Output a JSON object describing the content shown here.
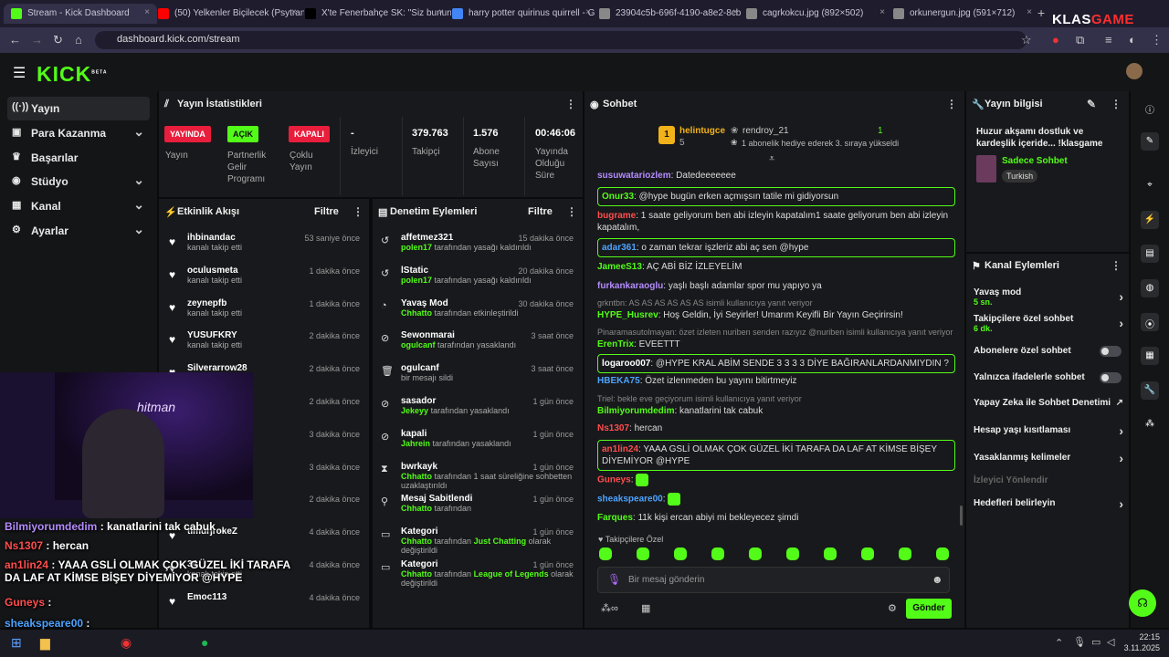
{
  "browser": {
    "tabs": [
      {
        "title": "Stream - Kick Dashboard",
        "active": true,
        "color": "#53fc18"
      },
      {
        "title": "(50) Yelkenler Biçilecek (Psytran",
        "color": "#ff0000"
      },
      {
        "title": "X'te Fenerbahçe SK: \"Siz bunun",
        "color": "#000000"
      },
      {
        "title": "harry potter quirinus quirrell - G",
        "color": "#4285f4"
      },
      {
        "title": "23904c5b-696f-4190-a8e2-8cb",
        "color": "#888888"
      },
      {
        "title": "cagrkokcu.jpg (892×502)",
        "color": "#888888"
      },
      {
        "title": "orkunergun.jpg (591×712)",
        "color": "#888888"
      }
    ],
    "url": "dashboard.kick.com/stream",
    "watermark_a": "KLAS",
    "watermark_b": "GAME"
  },
  "kick": {
    "logo": "KICK",
    "beta": "BETA"
  },
  "sidebar": {
    "items": [
      {
        "label": "Yayın",
        "icon": "((·))",
        "selected": true
      },
      {
        "label": "Para Kazanma",
        "icon": "▣",
        "chevron": true
      },
      {
        "label": "Başarılar",
        "icon": "♛"
      },
      {
        "label": "Stüdyo",
        "icon": "◉",
        "chevron": true
      },
      {
        "label": "Kanal",
        "icon": "▦",
        "chevron": true
      },
      {
        "label": "Ayarlar",
        "icon": "⚙",
        "chevron": true
      }
    ]
  },
  "stats": {
    "title": "Yayın İstatistikleri",
    "live_badge": "YAYINDA",
    "live_label": "Yayın",
    "partner_badge": "AÇIK",
    "partner_label": "Partnerlik Gelir Programı",
    "multi_badge": "KAPALI",
    "multi_label": "Çoklu Yayın",
    "viewers_val": "-",
    "viewers_label": "İzleyici",
    "followers_val": "379.763",
    "followers_label": "Takipçi",
    "subs_val": "1.576",
    "subs_label": "Abone Sayısı",
    "uptime_val": "00:46:06",
    "uptime_label": "Yayında Olduğu Süre"
  },
  "activity": {
    "title": "Etkinlik Akışı",
    "filter": "Filtre",
    "rows": [
      {
        "name": "ihbinandac",
        "sub": "kanalı takip etti",
        "time": "53 saniye önce"
      },
      {
        "name": "oculusmeta",
        "sub": "kanalı takip etti",
        "time": "1 dakika önce"
      },
      {
        "name": "zeynepfb",
        "sub": "kanalı takip etti",
        "time": "1 dakika önce"
      },
      {
        "name": "YUSUFKRY",
        "sub": "kanalı takip etti",
        "time": "2 dakika önce"
      },
      {
        "name": "Silverarrow28",
        "sub": "",
        "time": "2 dakika önce"
      },
      {
        "name": "",
        "sub": "",
        "time": "2 dakika önce"
      },
      {
        "name": "",
        "sub": "",
        "time": "3 dakika önce"
      },
      {
        "name": "dSti",
        "sub": "",
        "time": "3 dakika önce"
      },
      {
        "name": "",
        "sub": "gönderdi",
        "time": "2 dakika önce"
      },
      {
        "name": "timurjrokeZ",
        "sub": "",
        "time": "4 dakika önce"
      },
      {
        "name": "34",
        "sub": "kanalı takip etti",
        "time": "4 dakika önce"
      },
      {
        "name": "Emoc113",
        "sub": "",
        "time": "4 dakika önce"
      }
    ]
  },
  "moderation": {
    "title": "Denetim Eylemleri",
    "filter": "Filtre",
    "rows": [
      {
        "icon": "↺",
        "name": "affetmez321",
        "actor": "polen17",
        "text": "tarafından yasağı kaldırıldı",
        "time": "15 dakika önce"
      },
      {
        "icon": "↺",
        "name": "lStatic",
        "actor": "polen17",
        "text": "tarafından yasağı kaldırıldı",
        "time": "20 dakika önce"
      },
      {
        "icon": "◔",
        "name": "Yavaş Mod",
        "actor": "Chhatto",
        "text": "tarafından etkinleştirildi",
        "time": "30 dakika önce"
      },
      {
        "icon": "⊘",
        "name": "Sewonmarai",
        "actor": "ogulcanf",
        "text": "tarafından yasaklandı",
        "time": "3 saat önce"
      },
      {
        "icon": "🗑",
        "name": "ogulcanf",
        "actor": "",
        "text": "bir mesajı sildi",
        "time": "3 saat önce"
      },
      {
        "icon": "⊘",
        "name": "sasador",
        "actor": "Jekeyy",
        "text": "tarafından yasaklandı",
        "time": "1 gün önce"
      },
      {
        "icon": "⊘",
        "name": "kapali",
        "actor": "Jahrein",
        "text": "tarafından yasaklandı",
        "time": "1 gün önce"
      },
      {
        "icon": "⧗",
        "name": "bwrkayk",
        "actor": "Chhatto",
        "text": "tarafından 1 saat süreliğine sohbetten uzaklaştırıldı",
        "time": "1 gün önce"
      },
      {
        "icon": "⚲",
        "name": "Mesaj Sabitlendi",
        "actor": "Chhatto",
        "text": "tarafından",
        "time": "1 gün önce"
      },
      {
        "icon": "▭",
        "name": "Kategori",
        "actor": "Chhatto",
        "text": "tarafından",
        "green2": "Just Chatting",
        "text2": "olarak değiştirildi",
        "time": "1 gün önce"
      },
      {
        "icon": "▭",
        "name": "Kategori",
        "actor": "Chhatto",
        "text": "tarafından",
        "green2": "League of Legends",
        "text2": "olarak değiştirildi",
        "time": "1 gün önce"
      }
    ]
  },
  "chat": {
    "title": "Sohbet",
    "leader1_name": "helintugce",
    "leader1_count": "5",
    "leader2_name": "rendroy_21",
    "leader2_count": "1",
    "leader2_sub": "1 abonelik hediye ederek 3. sıraya yükseldi",
    "messages": [
      {
        "user": "susuwatariozlem",
        "color": "#b58cff",
        "text": "Datedeeeeeee"
      },
      {
        "user": "Onur33",
        "color": "#53fc18",
        "text": "@hype bugün erken açmışsın tatile mi gidiyorsun",
        "boxed": true
      },
      {
        "user": "bugrame",
        "color": "#ff4d4d",
        "text": "1 saate geliyorum ben abi izleyin kapatalım1 saate geliyorum ben abi izleyin kapatalım,"
      },
      {
        "user": "adar361",
        "color": "#4da3ff",
        "text": "o zaman tekrar işzleriz abi aç sen @hype",
        "boxed": true
      },
      {
        "user": "JameeS13",
        "color": "#53fc18",
        "text": "AÇ ABİ BİZ İZLEYELİM"
      },
      {
        "user": "furkankaraoglu",
        "color": "#b58cff",
        "text": "yaşlı başlı adamlar spor mu yapıyo ya"
      },
      {
        "reply": "grkntbn: AS AS AS AS AS AS isimli kullanıcıya yanıt veriyor",
        "user": "HYPE_Husrev",
        "color": "#53fc18",
        "text": "Hoş Geldin, İyi Seyirler! Umarım Keyifli Bir Yayın Geçirirsin!"
      },
      {
        "reply": "Pinaramasutolmayan: özet izleten nuriben senden razıyız @nuriben isimli kullanıcıya yanıt veriyor",
        "user": "ErenTrix",
        "color": "#53fc18",
        "text": "EVEETTT"
      },
      {
        "user": "logaroo007",
        "color": "#ffffff",
        "text": "@HYPE KRAL ABİM SENDE 3 3 3 3 DİYE BAĞIRANLARDANMIYDIN ?",
        "boxed": true
      },
      {
        "user": "HBEKA75",
        "color": "#4da3ff",
        "text": "Özet izlenmeden bu yayını bitirtmeyiz"
      },
      {
        "reply": "Triel: bekle eve geçiyorum isimli kullanıcıya yanıt veriyor",
        "user": "Bilmiyorumdedim",
        "color": "#53fc18",
        "text": "kanatlarini tak cabuk"
      },
      {
        "user": "Ns1307",
        "color": "#ff4d4d",
        "text": "hercan"
      },
      {
        "user": "an1lin24",
        "color": "#ff4d4d",
        "text": "YAAA GSLİ OLMAK ÇOK GÜZEL İKİ TARAFA DA LAF AT KİMSE BİŞEY DİYEMİYOR @HYPE",
        "boxed": true
      },
      {
        "user": "Guneys",
        "color": "#ff4d4d",
        "text": ""
      },
      {
        "user": "sheakspeare00",
        "color": "#4da3ff",
        "text": ""
      },
      {
        "user": "Farques",
        "color": "#53fc18",
        "text": "11k kişi ercan abiyi mi bekleyecez şimdi"
      }
    ],
    "followers_only": "Takipçilere Özel",
    "input_placeholder": "Bir mesaj gönderin",
    "send": "Gönder"
  },
  "info": {
    "title": "Yayın bilgisi",
    "stream_title": "Huzur akşamı dostluk ve kardeşlik içeride...  !klasgame",
    "category": "Sadece Sohbet",
    "language": "Turkish"
  },
  "actions": {
    "title": "Kanal Eylemleri",
    "slow_mode": "Yavaş mod",
    "slow_val": "5 sn.",
    "followers_chat": "Takipçilere özel sohbet",
    "followers_val": "6 dk.",
    "subs_chat": "Abonelere özel sohbet",
    "emotes_chat": "Yalnızca ifadelerle sohbet",
    "ai_mod": "Yapay Zeka ile Sohbet Denetimi",
    "age": "Hesap yaşı kısıtlaması",
    "banned_words": "Yasaklanmış kelimeler",
    "redirect": "İzleyici Yönlendir",
    "goals": "Hedefleri belirleyin"
  },
  "overlay": {
    "signature": "hitman",
    "lines": [
      {
        "user": "Bilmiyorumdedim",
        "color": "#b58cff",
        "text": ": kanatlarini tak cabuk"
      },
      {
        "user": "Ns1307",
        "color": "#ff4d4d",
        "text": ": hercan"
      },
      {
        "user": "an1lin24",
        "color": "#ff4d4d",
        "text": ": YAAA GSLİ OLMAK ÇOK GÜZEL İKİ TARAFA DA LAF AT KİMSE BİŞEY DİYEMİYOR @HYPE"
      },
      {
        "user": "Guneys",
        "color": "#ff4d4d",
        "text": ":"
      },
      {
        "user": "sheakspeare00",
        "color": "#4da3ff",
        "text": ":"
      },
      {
        "user": "",
        "color": "#ffffff",
        "text": ": 11k kişi ercan abiyi mi bekleyecez şimdi"
      }
    ]
  },
  "taskbar": {
    "time": "22:15",
    "date": "3.11.2025"
  }
}
